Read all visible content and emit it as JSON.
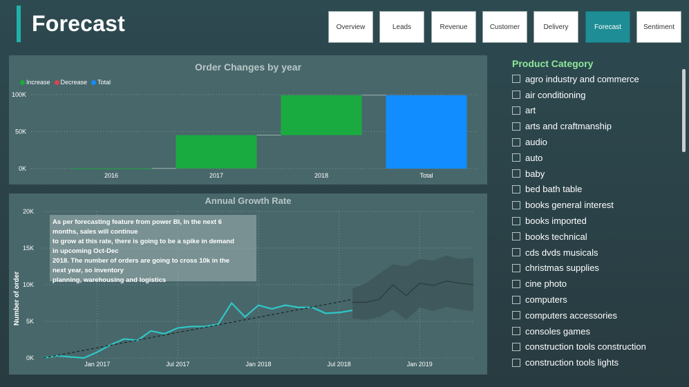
{
  "header": {
    "title": "Forecast"
  },
  "nav": [
    {
      "label": "Overview",
      "active": false
    },
    {
      "label": "Leads",
      "active": false
    },
    {
      "label": "Revenue",
      "active": false
    },
    {
      "label": "Customer",
      "active": false
    },
    {
      "label": "Delivery",
      "active": false
    },
    {
      "label": "Forecast",
      "active": true
    },
    {
      "label": "Sentiment",
      "active": false
    }
  ],
  "order_changes": {
    "title": "Order Changes by year",
    "legend": [
      "Increase",
      "Decrease",
      "Total"
    ],
    "colors": {
      "increase": "#1aab40",
      "decrease": "#d64550",
      "total": "#118dff"
    }
  },
  "growth": {
    "title": "Annual Growth Rate",
    "ylabel": "Number of order",
    "annotation": [
      "As per forecasting feature from power BI, In the next 6",
      "months, sales will continue",
      "to grow at this rate, there is going to be a spike in demand",
      "in upcoming Oct-Dec",
      "2018. The number of orders are going to cross 10k in the",
      "next year, so inventory",
      "planning, warehousing and logistics"
    ]
  },
  "chart_data": [
    {
      "type": "bar",
      "subtype": "waterfall",
      "title": "Order Changes by year",
      "categories": [
        "2016",
        "2017",
        "2018",
        "Total"
      ],
      "values": [
        300,
        45000,
        54000,
        99300
      ],
      "kinds": [
        "increase",
        "increase",
        "increase",
        "total"
      ],
      "yticks": [
        "0K",
        "50K",
        "100K"
      ],
      "ylim": [
        0,
        100000
      ],
      "legend": [
        "Increase",
        "Decrease",
        "Total"
      ],
      "legend_position": "top-left"
    },
    {
      "type": "line",
      "title": "Annual Growth Rate",
      "ylabel": "Number of order",
      "xticks": [
        "Jan 2017",
        "Jul 2017",
        "Jan 2018",
        "Jul 2018",
        "Jan 2019"
      ],
      "yticks": [
        "0K",
        "5K",
        "10K",
        "15K",
        "20K"
      ],
      "ylim": [
        0,
        20000
      ],
      "xlim": [
        "2016-09",
        "2019-05"
      ],
      "series": [
        {
          "role": "actual",
          "x": [
            "2016-09",
            "2016-10",
            "2016-12",
            "2017-01",
            "2017-02",
            "2017-03",
            "2017-04",
            "2017-05",
            "2017-06",
            "2017-07",
            "2017-08",
            "2017-09",
            "2017-10",
            "2017-11",
            "2017-12",
            "2018-01",
            "2018-02",
            "2018-03",
            "2018-04",
            "2018-05",
            "2018-06",
            "2018-07",
            "2018-08"
          ],
          "y": [
            0,
            300,
            0,
            800,
            1800,
            2600,
            2400,
            3700,
            3300,
            4100,
            4300,
            4300,
            4600,
            7500,
            5600,
            7200,
            6700,
            7200,
            6900,
            6900,
            6100,
            6200,
            6500
          ]
        },
        {
          "role": "trend",
          "x": [
            "2016-09",
            "2018-08"
          ],
          "y": [
            0,
            8000
          ]
        },
        {
          "role": "forecast",
          "x": [
            "2018-08",
            "2018-09",
            "2018-10",
            "2018-11",
            "2018-12",
            "2019-01",
            "2019-02",
            "2019-03",
            "2019-04",
            "2019-05"
          ],
          "y": [
            7600,
            7600,
            8000,
            10000,
            8500,
            10200,
            9900,
            10500,
            10200,
            10000
          ]
        },
        {
          "role": "forecast-band",
          "x": [
            "2018-08",
            "2018-09",
            "2018-10",
            "2018-11",
            "2018-12",
            "2019-01",
            "2019-02",
            "2019-03",
            "2019-04",
            "2019-05"
          ],
          "upper": [
            9500,
            10200,
            11500,
            12800,
            12500,
            13500,
            13300,
            14000,
            13500,
            13700
          ],
          "lower": [
            5400,
            5200,
            5600,
            6600,
            5200,
            6900,
            6400,
            7000,
            6600,
            6400
          ]
        }
      ],
      "colors": {
        "actual": "#2ec8c8",
        "trend": "#1d2a2c",
        "forecast": "#2a3d3f",
        "band": "#3e5658"
      }
    }
  ],
  "product_category": {
    "title": "Product Category",
    "items": [
      "agro industry and commerce",
      "air conditioning",
      "art",
      "arts and craftmanship",
      "audio",
      "auto",
      "baby",
      "bed bath table",
      "books general interest",
      "books imported",
      "books technical",
      "cds dvds musicals",
      "christmas supplies",
      "cine photo",
      "computers",
      "computers accessories",
      "consoles games",
      "construction tools construction",
      "construction tools lights"
    ]
  }
}
